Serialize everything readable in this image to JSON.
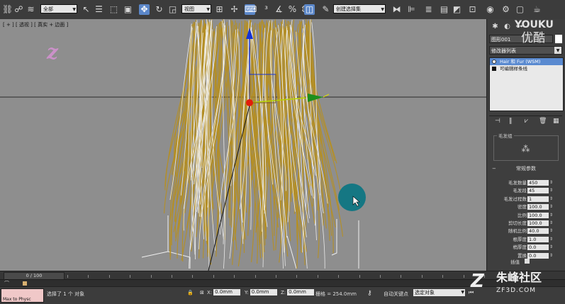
{
  "toolbar": {
    "filter_select": "全部",
    "refcoord_select": "视图",
    "named_selection": "创建选择集",
    "icons": [
      "undo-icon",
      "redo-icon",
      "select-link-icon",
      "unlink-icon",
      "bind-spacewarp-icon",
      "select-object-icon",
      "select-by-name-icon",
      "rect-region-icon",
      "window-crossing-icon",
      "move-icon",
      "rotate-icon",
      "scale-icon",
      "pivot-icon",
      "select-manipulate-icon",
      "snap-3-icon",
      "angle-snap-icon",
      "percent-snap-icon",
      "spinner-snap-icon",
      "edit-named-sel-icon",
      "mirror-icon",
      "align-icon",
      "layer-icon",
      "curve-editor-icon",
      "schematic-icon",
      "material-editor-icon",
      "render-setup-icon",
      "rendered-frame-icon",
      "render-icon"
    ]
  },
  "viewport": {
    "label": "[ + ] [ 透视 ] [ 真实 + 边面 ]",
    "watermark_letter": "z"
  },
  "command_panel": {
    "object_name": "图形001",
    "modifier_list": "修改器列表",
    "stack": [
      {
        "label": "Hair 和 Fur (WSM)",
        "selected": true
      },
      {
        "label": "可编辑样条线",
        "selected": false
      }
    ],
    "hair_group_title": "毛发组",
    "hair_preview_glyph": "⁂",
    "rollup_general": "常规参数",
    "params": [
      {
        "label": "毛发数量",
        "value": "450"
      },
      {
        "label": "毛发段",
        "value": "45"
      },
      {
        "label": "毛发过程数",
        "value": "1"
      },
      {
        "label": "密度",
        "value": "100.0"
      },
      {
        "label": "比例",
        "value": "100.0"
      },
      {
        "label": "剪切长度",
        "value": "100.0"
      },
      {
        "label": "随机比例",
        "value": "40.0"
      },
      {
        "label": "根厚度",
        "value": "1.0"
      },
      {
        "label": "梢厚度",
        "value": "0.0"
      },
      {
        "label": "置换",
        "value": "0.0"
      }
    ],
    "interp_label": "插值",
    "youku_logo": "YOUKU",
    "youku_sub": "优酷"
  },
  "timeslider": {
    "frame_label": "0 / 100"
  },
  "status": {
    "maxscript": "Max to Physc",
    "selection_text": "选择了 1 个 对象",
    "x_label": "X:",
    "x_value": "0.0mm",
    "y_label": "Y:",
    "y_value": "0.0mm",
    "z_label": "Z:",
    "z_value": "0.0mm",
    "grid": "栅格 = 254.0mm",
    "autokey": "自动关键点",
    "key_filter": "选定对象"
  },
  "site_watermark": {
    "name": "朱峰社区",
    "url": "ZF3D.COM"
  },
  "colors": {
    "viewport_bg": "#8e8e8e",
    "hair_gold": "#b8901e",
    "hair_white": "#f2f2f2",
    "gizmo_x": "#1d8f1d",
    "gizmo_y": "#b6d400",
    "gizmo_z": "#1633d4",
    "cursor_teal": "#0f7683"
  }
}
